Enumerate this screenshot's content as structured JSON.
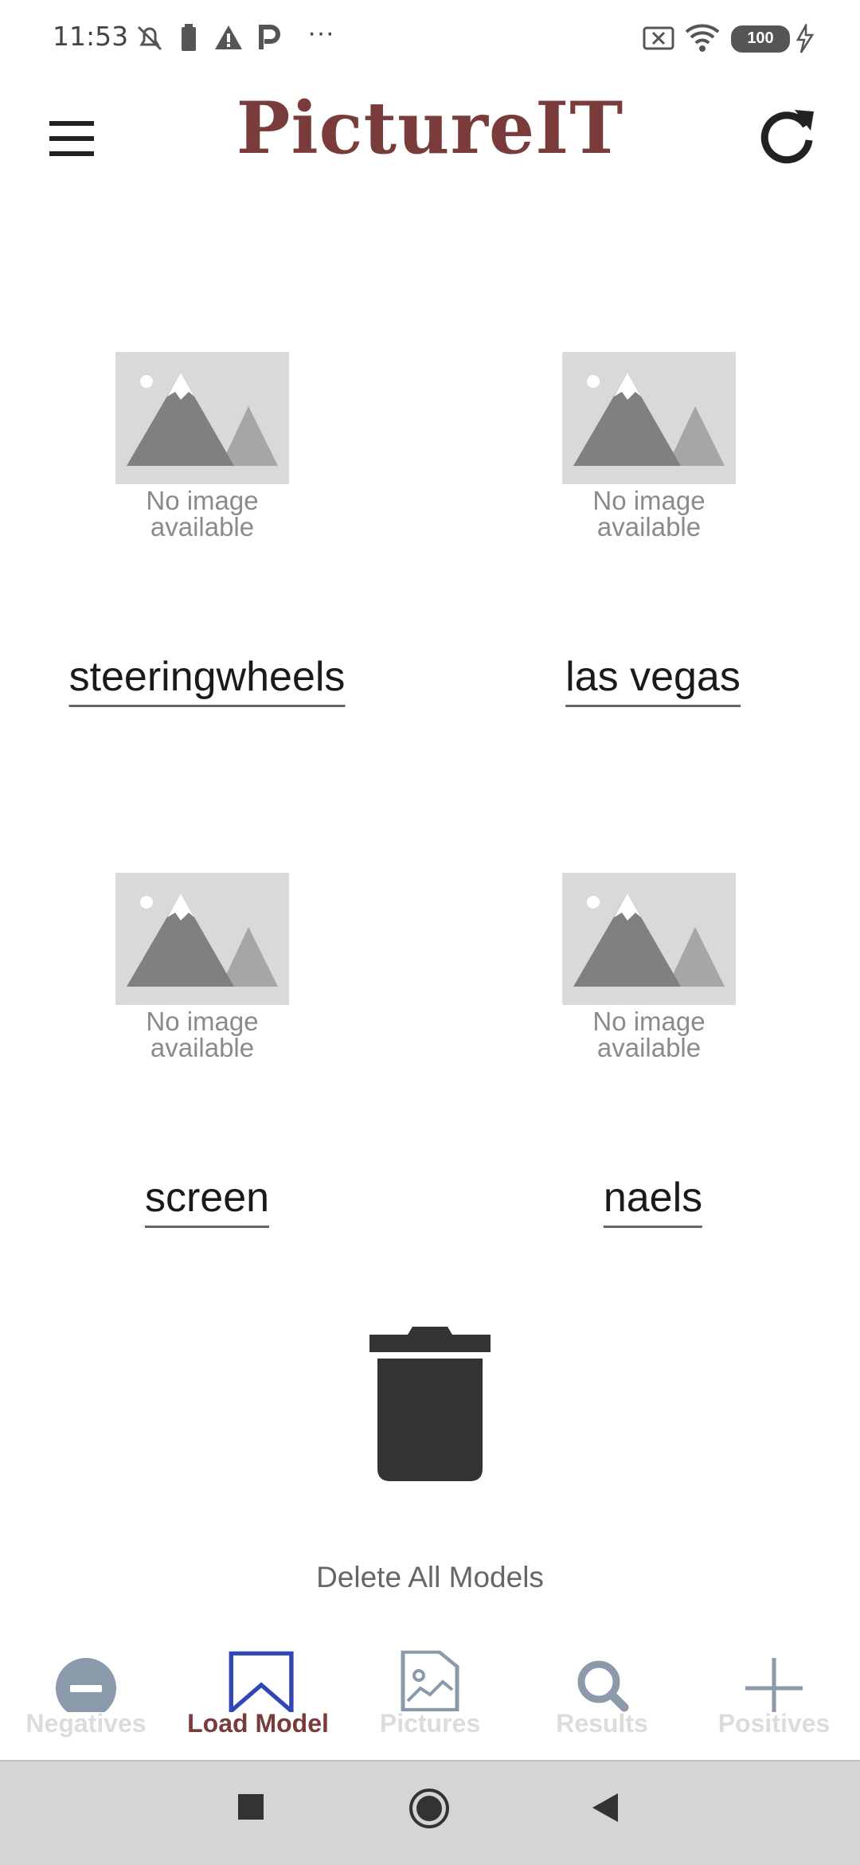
{
  "status_bar": {
    "time": "11:53",
    "battery": "100",
    "overflow": "···"
  },
  "app": {
    "title": "PictureIT",
    "title_color": "#7a3b3b"
  },
  "icons": {
    "menu": "menu-icon",
    "refresh": "refresh-icon",
    "trash": "trash-icon"
  },
  "models": [
    {
      "name": "steeringwheels",
      "image_text_line1": "No image",
      "image_text_line2": "available"
    },
    {
      "name": "las vegas",
      "image_text_line1": "No image",
      "image_text_line2": "available"
    },
    {
      "name": "screen",
      "image_text_line1": "No image",
      "image_text_line2": "available"
    },
    {
      "name": "naels",
      "image_text_line1": "No image",
      "image_text_line2": "available"
    }
  ],
  "delete_all_label": "Delete All Models",
  "bottom_nav": {
    "items": [
      {
        "label": "Negatives",
        "icon": "minus-circle-icon",
        "active": false
      },
      {
        "label": "Load Model",
        "icon": "bookmark-icon",
        "active": true
      },
      {
        "label": "Pictures",
        "icon": "picture-file-icon",
        "active": false
      },
      {
        "label": "Results",
        "icon": "search-icon",
        "active": false
      },
      {
        "label": "Positives",
        "icon": "plus-icon",
        "active": false
      }
    ],
    "active_color": "#7a3b3b",
    "inactive_color": "#dcdcdc"
  }
}
